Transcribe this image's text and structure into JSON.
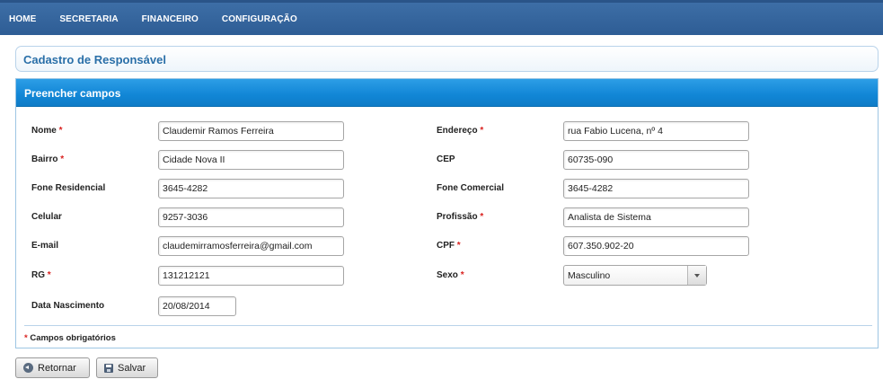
{
  "nav": {
    "items": [
      "HOME",
      "SECRETARIA",
      "FINANCEIRO",
      "CONFIGURAÇÃO"
    ]
  },
  "page": {
    "title": "Cadastro de Responsável"
  },
  "panel": {
    "header": "Preencher campos",
    "required_marker": "*",
    "fields": {
      "nome": {
        "label": "Nome",
        "value": "Claudemir Ramos Ferreira"
      },
      "endereco": {
        "label": "Endereço",
        "value": "rua Fabio Lucena, nº 4"
      },
      "bairro": {
        "label": "Bairro",
        "value": "Cidade Nova II"
      },
      "cep": {
        "label": "CEP",
        "value": "60735-090"
      },
      "fone_residencial": {
        "label": "Fone Residencial",
        "value": "3645-4282"
      },
      "fone_comercial": {
        "label": "Fone Comercial",
        "value": "3645-4282"
      },
      "celular": {
        "label": "Celular",
        "value": "9257-3036"
      },
      "profissao": {
        "label": "Profissão",
        "value": "Analista de Sistema"
      },
      "email": {
        "label": "E-mail",
        "value": "claudemirramosferreira@gmail.com"
      },
      "cpf": {
        "label": "CPF",
        "value": "607.350.902-20"
      },
      "rg": {
        "label": "RG",
        "value": "131212121"
      },
      "sexo": {
        "label": "Sexo",
        "value": "Masculino"
      },
      "data_nascimento": {
        "label": "Data Nascimento",
        "value": "20/08/2014"
      }
    },
    "footnote": "Campos obrigatórios"
  },
  "buttons": {
    "back": "Retornar",
    "save": "Salvar"
  },
  "icons": {
    "back": "arrow-left-circle-icon",
    "save": "floppy-disk-icon",
    "dropdown": "chevron-down-icon"
  }
}
